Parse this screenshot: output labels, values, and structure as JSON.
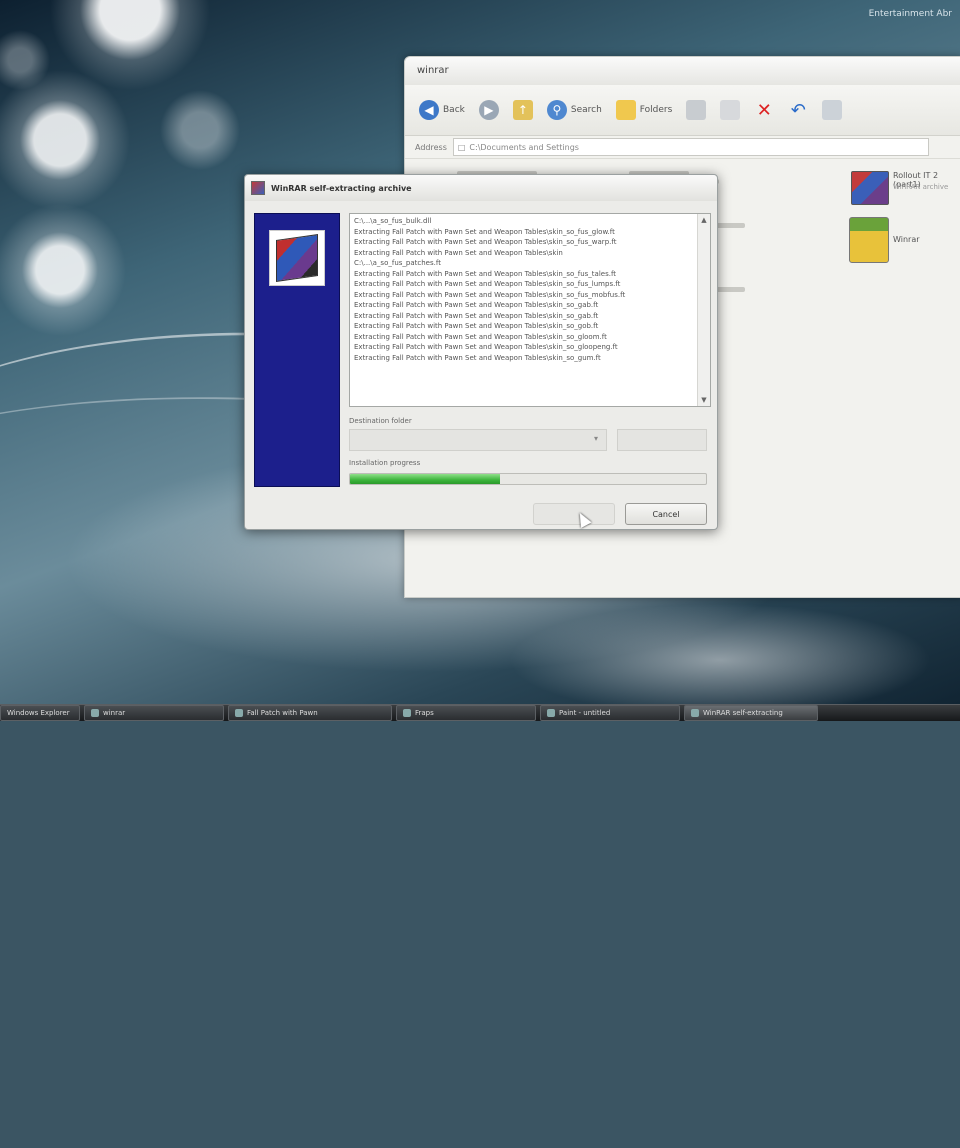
{
  "desktop": {
    "top_status": "Entertainment Abr"
  },
  "explorer": {
    "title": "winrar",
    "toolbar": {
      "back_label": "Back",
      "search_label": "Search",
      "folders_label": "Folders"
    },
    "address_label": "Address",
    "address_value": "C:\\Documents and Settings",
    "files": [
      {
        "name": "Rollout IT 2 (part1)",
        "sub": "WinRAR archive"
      },
      {
        "name": "Winrar",
        "sub": ""
      }
    ]
  },
  "dialog": {
    "title": "WinRAR self-extracting archive",
    "log_lines": [
      "C:\\...\\a_so_fus_bulk.dll",
      "Extracting Fall Patch with Pawn Set and Weapon Tables\\skin_so_fus_glow.ft",
      "Extracting Fall Patch with Pawn Set and Weapon Tables\\skin_so_fus_warp.ft",
      "Extracting Fall Patch with Pawn Set and Weapon Tables\\skin",
      "C:\\...\\a_so_fus_patches.ft",
      "Extracting Fall Patch with Pawn Set and Weapon Tables\\skin_so_fus_tales.ft",
      "Extracting Fall Patch with Pawn Set and Weapon Tables\\skin_so_fus_lumps.ft",
      "Extracting Fall Patch with Pawn Set and Weapon Tables\\skin_so_fus_mobfus.ft",
      "Extracting Fall Patch with Pawn Set and Weapon Tables\\skin_so_gab.ft",
      "Extracting Fall Patch with Pawn Set and Weapon Tables\\skin_so_gab.ft",
      "Extracting Fall Patch with Pawn Set and Weapon Tables\\skin_so_gob.ft",
      "Extracting Fall Patch with Pawn Set and Weapon Tables\\skin_so_gloom.ft",
      "Extracting Fall Patch with Pawn Set and Weapon Tables\\skin_so_gloopeng.ft",
      "Extracting Fall Patch with Pawn Set and Weapon Tables\\skin_so_gum.ft"
    ],
    "destination_label": "Destination folder",
    "destination_value": "",
    "progress_label": "Installation progress",
    "progress_fraction": 0.42,
    "cancel_label": "Cancel"
  },
  "taskbar": {
    "items": [
      {
        "label": "Windows Explorer"
      },
      {
        "label": "winrar"
      },
      {
        "label": "Fall Patch with Pawn"
      },
      {
        "label": "Fraps"
      },
      {
        "label": "Paint - untitled"
      },
      {
        "label": "WinRAR self-extracting"
      }
    ]
  }
}
